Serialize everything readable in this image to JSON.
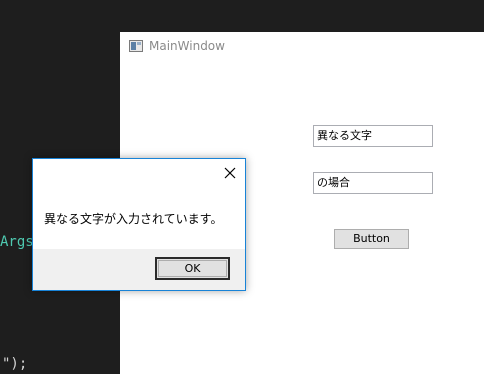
{
  "editor": {
    "code_fragment_args": "Args",
    "code_fragment_tail": "\");"
  },
  "main_window": {
    "title": "MainWindow",
    "textbox1_value": "異なる文字",
    "textbox2_value": "の場合",
    "button_label": "Button"
  },
  "message_box": {
    "close_icon": "close-icon",
    "message": "異なる文字が入力されています。",
    "ok_label": "OK"
  },
  "colors": {
    "editor_background": "#1e1e1e",
    "editor_type_color": "#4ec9b0",
    "dialog_border": "#1883d7",
    "dialog_footer": "#f0f0f0"
  }
}
